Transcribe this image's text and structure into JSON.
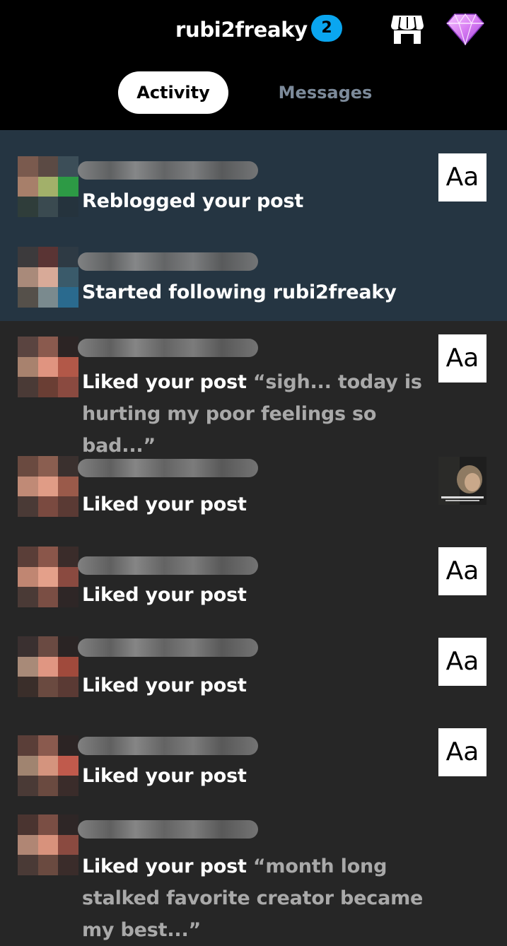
{
  "header": {
    "blog_name": "rubi2freaky",
    "unread_count": "2",
    "shop_icon": "shop-icon",
    "premium_icon": "gem-icon"
  },
  "tabs": [
    {
      "label": "Activity",
      "active": true
    },
    {
      "label": "Messages",
      "active": false
    }
  ],
  "colors": {
    "header_bg": "#000000",
    "list_bg": "#262626",
    "unread_bg": "#253542",
    "badge": "#0aa6f0",
    "muted_text": "#a9a9a9",
    "inactive_tab": "#7c8a9a"
  },
  "notifications": [
    {
      "action": "Reblogged your post",
      "quote": "",
      "thumb": "Aa",
      "unread": true
    },
    {
      "action": "Started following rubi2freaky",
      "quote": "",
      "thumb": "",
      "unread": true
    },
    {
      "action": "Liked your post",
      "quote": "“sigh... today is hurting my poor feelings so bad...”",
      "thumb": "Aa",
      "unread": false
    },
    {
      "action": "Liked your post",
      "quote": "",
      "thumb": "image",
      "unread": false
    },
    {
      "action": "Liked your post",
      "quote": "",
      "thumb": "Aa",
      "unread": false
    },
    {
      "action": "Liked your post",
      "quote": "",
      "thumb": "Aa",
      "unread": false
    },
    {
      "action": "Liked your post",
      "quote": "",
      "thumb": "Aa",
      "unread": false
    },
    {
      "action": "Liked your post",
      "quote": "“month long stalked favorite creator became my best...”",
      "thumb": "",
      "unread": false
    }
  ]
}
